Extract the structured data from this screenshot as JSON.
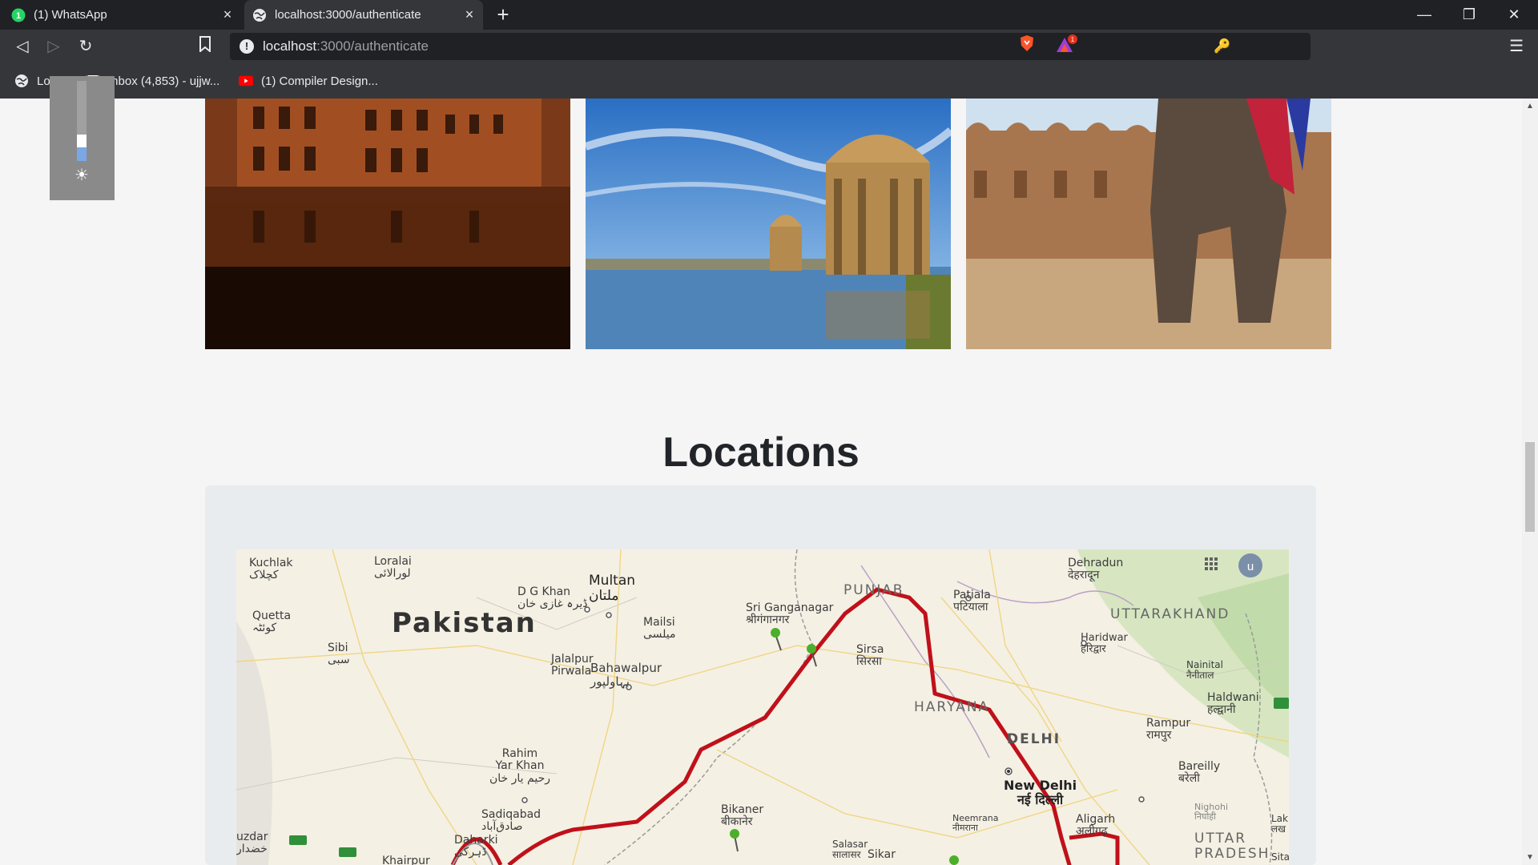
{
  "browser": {
    "tabs": [
      {
        "title": "(1) WhatsApp",
        "badge": "1"
      },
      {
        "title": "localhost:3000/authenticate"
      }
    ],
    "address_bar": {
      "host": "localhost",
      "path": ":3000/authenticate"
    },
    "rewards_badge": "1",
    "bookmarks": [
      {
        "label": "Login",
        "icon": "globe-icon"
      },
      {
        "label": "Inbox (4,853) - ujjw...",
        "icon": "gmail-icon"
      },
      {
        "label": "(1) Compiler Design...",
        "icon": "youtube-icon"
      }
    ]
  },
  "page": {
    "gallery": [
      {
        "alt": "haveli-reflection-photo"
      },
      {
        "alt": "lake-chhatri-photo"
      },
      {
        "alt": "elephant-fort-photo"
      }
    ],
    "locations_heading": "Locations",
    "map": {
      "badge_letter": "u",
      "labels": {
        "pakistan": "Pakistan",
        "punjab": "PUNJAB",
        "haryana": "HARYANA",
        "uttarakhand": "UTTARAKHAND",
        "delhi": "DELHI",
        "uttar_pradesh": "UTTAR\nPRADESH",
        "kuchlak": "Kuchlak\nکچلاک",
        "quetta": "Quetta\nکوئٹہ",
        "sibi": "Sibi\nسبی",
        "loralai": "Loralai\nلورالائی",
        "dgkhan": "D G Khan\nڈیرہ غازی خان",
        "multan": "Multan\nملتان",
        "mailsi": "Mailsi\nمیلسی",
        "jalalpur": "Jalalpur\nPirwala",
        "bahawalpur": "Bahawalpur\nبہاولپور",
        "rahim": "Rahim\nYar Khan\nرحیم یار خان",
        "sadiqabad": "Sadiqabad\nصادق‌آباد",
        "daharki": "Daharki\nڈہرکی",
        "khairpur": "Khairpur",
        "uzdar": "uzdar\nخضدار",
        "sriganganagar": "Sri Ganganagar\nश्रीगंगानगर",
        "sirsa": "Sirsa\nसिरसा",
        "patiala": "Patiala\nपटियाला",
        "dehradun": "Dehradun\nदेहरादून",
        "haridwar": "Haridwar\nहरिद्वार",
        "nainital": "Nainital\nनैनीताल",
        "haldwani": "Haldwani\nहल्द्वानी",
        "rampur": "Rampur\nरामपुर",
        "bareilly": "Bareilly\nबरेली",
        "newdelhi": "New Delhi\nनई दिल्ली",
        "aligarh": "Aligarh\nअलीगढ़",
        "neemrana": "Neemrana\nनीमराना",
        "bikaner": "Bikaner\nबीकानेर",
        "salasar": "Salasar\nसालासर",
        "sikar": "Sikar",
        "nighoi": "Nighohi\nनिघोही",
        "lak": "Lak\nलख",
        "sita": "Sita"
      }
    }
  },
  "colors": {
    "route": "#c0101a",
    "pin": "#4caf2a",
    "chrome_dark": "#202124",
    "chrome_mid": "#35363a"
  }
}
